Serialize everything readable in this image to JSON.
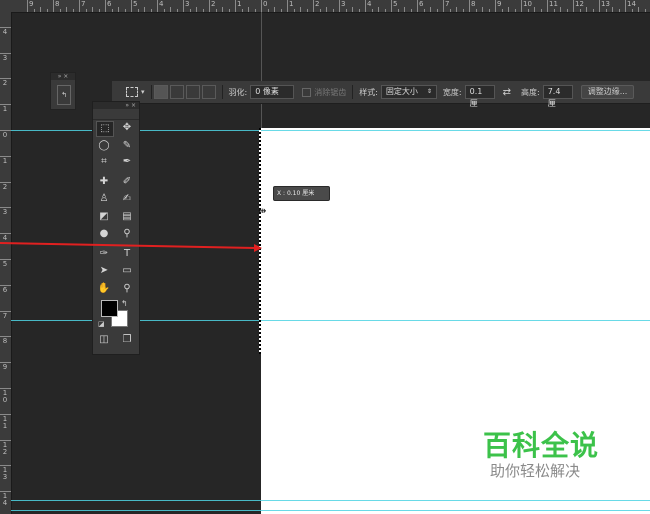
{
  "rulers": {
    "top_labels": [
      "9",
      "8",
      "7",
      "6",
      "5",
      "4",
      "3",
      "2",
      "1",
      "0",
      "1",
      "2",
      "3",
      "4",
      "5",
      "6",
      "7",
      "8",
      "9",
      "10",
      "11",
      "12",
      "13",
      "14"
    ],
    "left_labels": [
      "4",
      "3",
      "2",
      "1",
      "0",
      "1",
      "2",
      "3",
      "4",
      "5",
      "6",
      "7",
      "8",
      "9",
      "1\n0",
      "1\n1",
      "1\n2",
      "1\n3",
      "1\n4"
    ]
  },
  "options_bar": {
    "feather_label": "羽化:",
    "feather_value": "0 像素",
    "antialias_label": "消除锯齿",
    "style_label": "样式:",
    "style_value": "固定大小",
    "width_label": "宽度:",
    "width_value": "0.1 厘",
    "height_label": "高度:",
    "height_value": "7.4 厘",
    "refine_edge_label": "调整边缘..."
  },
  "tooltip": {
    "text": "X : 0.10 厘米"
  },
  "toolbox": {
    "tools": [
      {
        "name": "rect-marquee-tool",
        "glyph": "⬚"
      },
      {
        "name": "move-tool",
        "glyph": "✥"
      },
      {
        "name": "lasso-tool",
        "glyph": "◯"
      },
      {
        "name": "quick-select-tool",
        "glyph": "✎"
      },
      {
        "name": "crop-tool",
        "glyph": "⌗"
      },
      {
        "name": "eyedropper-tool",
        "glyph": "✒"
      },
      {
        "name": "healing-brush-tool",
        "glyph": "✚"
      },
      {
        "name": "brush-tool",
        "glyph": "✐"
      },
      {
        "name": "clone-stamp-tool",
        "glyph": "♙"
      },
      {
        "name": "history-brush-tool",
        "glyph": "✍"
      },
      {
        "name": "eraser-tool",
        "glyph": "◩"
      },
      {
        "name": "gradient-tool",
        "glyph": "▤"
      },
      {
        "name": "blur-tool",
        "glyph": "●"
      },
      {
        "name": "dodge-tool",
        "glyph": "⚲"
      },
      {
        "name": "pen-tool",
        "glyph": "✑"
      },
      {
        "name": "type-tool",
        "glyph": "T"
      },
      {
        "name": "path-select-tool",
        "glyph": "➤"
      },
      {
        "name": "shape-tool",
        "glyph": "▭"
      },
      {
        "name": "hand-tool",
        "glyph": "✋"
      },
      {
        "name": "zoom-tool",
        "glyph": "⚲"
      },
      {
        "name": "quick-mask-button",
        "glyph": "◫"
      },
      {
        "name": "screen-mode-button",
        "glyph": "❐"
      }
    ]
  },
  "watermark": {
    "title": "百科全说",
    "subtitle": "助你轻松解决"
  },
  "colors": {
    "guide": "#4fd3e3",
    "arrow": "#e02020",
    "watermark_green": "#3cc24a"
  }
}
